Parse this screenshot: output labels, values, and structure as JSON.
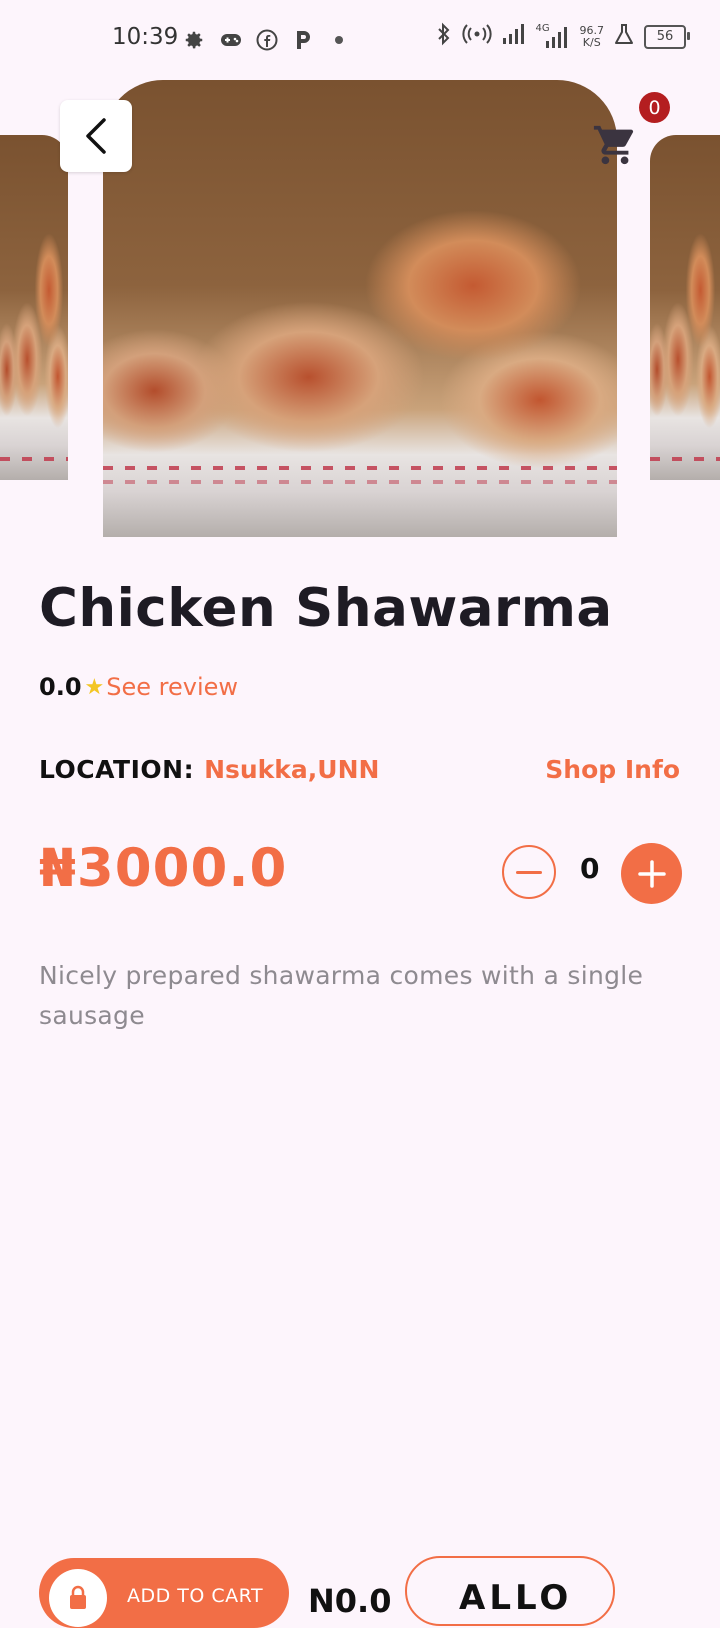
{
  "status_bar": {
    "time": "10:39",
    "speed_value": "96.7",
    "speed_unit": "K/S",
    "battery": "56",
    "network": "4G"
  },
  "header": {
    "cart_count": "0"
  },
  "product": {
    "name": "Chicken Shawarma",
    "rating": "0.0",
    "review_link": "See review",
    "location_label": "LOCATION:",
    "location": "Nsukka,UNN",
    "shop_info": "Shop Info",
    "price": "₦3000.0",
    "quantity": "0",
    "description": "Nicely prepared shawarma comes with a single sausage"
  },
  "bottom_bar": {
    "add_to_cart": "ADD TO CART",
    "total": "N0.0",
    "all_label": "ALLO"
  },
  "colors": {
    "accent": "#f26e46",
    "background": "#fdf5fc",
    "badge": "#b41e20",
    "star": "#f3c623"
  }
}
